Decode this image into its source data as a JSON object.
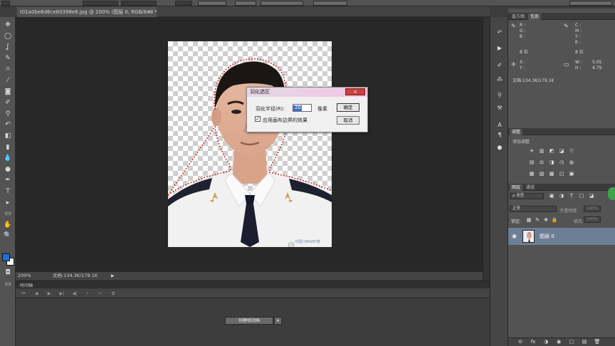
{
  "topbar": {
    "fields": [
      "",
      "",
      "",
      "",
      ""
    ],
    "buttons": [
      "",
      "",
      "",
      "",
      ""
    ]
  },
  "toolbox": {
    "tools": [
      {
        "name": "move-tool-icon",
        "glyph": "✥"
      },
      {
        "name": "marquee-tool-icon",
        "glyph": "◯"
      },
      {
        "name": "lasso-tool-icon",
        "glyph": "ʆ"
      },
      {
        "name": "quick-select-tool-icon",
        "glyph": "✎"
      },
      {
        "name": "crop-tool-icon",
        "glyph": "⌗"
      },
      {
        "name": "eyedropper-tool-icon",
        "glyph": "⁄"
      },
      {
        "name": "healing-brush-tool-icon",
        "glyph": "◙"
      },
      {
        "name": "brush-tool-icon",
        "glyph": "✐"
      },
      {
        "name": "clone-stamp-tool-icon",
        "glyph": "⚲"
      },
      {
        "name": "history-brush-tool-icon",
        "glyph": "↶"
      },
      {
        "name": "eraser-tool-icon",
        "glyph": "◧"
      },
      {
        "name": "gradient-tool-icon",
        "glyph": "▮"
      },
      {
        "name": "blur-tool-icon",
        "glyph": "💧"
      },
      {
        "name": "dodge-tool-icon",
        "glyph": "●"
      },
      {
        "name": "pen-tool-icon",
        "glyph": "✒"
      },
      {
        "name": "type-tool-icon",
        "glyph": "T"
      },
      {
        "name": "path-select-tool-icon",
        "glyph": "▸"
      },
      {
        "name": "shape-tool-icon",
        "glyph": "▭"
      },
      {
        "name": "hand-tool-icon",
        "glyph": "✋"
      },
      {
        "name": "zoom-tool-icon",
        "glyph": "🔍"
      }
    ],
    "foreground_color": "#1e6fd9",
    "background_color": "#ffffff"
  },
  "document": {
    "tab_title": "t01a0be6d6ce60398e6.jpg @ 200% (图层 0, RGB/8#) *",
    "tab_close": "×",
    "zoom": "200%",
    "doc_info": "文档:134.3K/179.1K",
    "watermark": "中国CHRANY尊"
  },
  "dialog": {
    "title": "羽化选区",
    "close": "×",
    "radius_label": "羽化半径(R):",
    "radius_value": "20",
    "unit": "像素",
    "checkbox_checked": true,
    "checkbox_label": "应用画布边界的效果",
    "ok": "确定",
    "cancel": "取消"
  },
  "timeline": {
    "tab": "时间轴",
    "create_button": "创建帧动画",
    "controls": [
      "⏮",
      "◀",
      "▶",
      "▶|",
      "◀|",
      "⚬",
      "✂",
      "⧉"
    ]
  },
  "right_panel": {
    "info_tabs": [
      "直方图",
      "信息"
    ],
    "info": {
      "r": "R :",
      "g": "G :",
      "b": "B :",
      "c": "C :",
      "m": "M :",
      "y_cmyk": "Y :",
      "k": "K :",
      "bits_left": "8 位",
      "bits_right": "8 位",
      "x": "X :",
      "y": "Y :",
      "w": "W :",
      "h": "H :",
      "w_value": "5.05",
      "h_value": "4.79",
      "doc": "文档:134.3K/179.1K"
    },
    "adjust_tab": "调整",
    "adjust_title": "添加调整",
    "adjust_icons": [
      "☀",
      "▥",
      "◩",
      "◪",
      "▽",
      "▤",
      "⚖",
      "◨",
      "◷",
      "◍",
      "▦",
      "▨",
      "▩",
      "◰",
      "▣"
    ],
    "layers_tabs": [
      "图层",
      "通道"
    ],
    "kind_filter": "ρ 类型",
    "blend_mode": "正常",
    "opacity_label": "不透明度:",
    "opacity_value": "100%",
    "lock_label": "锁定:",
    "fill_label": "填充:",
    "fill_value": "100%",
    "layer_name": "图层 0",
    "bottom_icons": [
      "⊖",
      "fx",
      "◑",
      "◉",
      "▢",
      "▤",
      "🗑"
    ]
  }
}
